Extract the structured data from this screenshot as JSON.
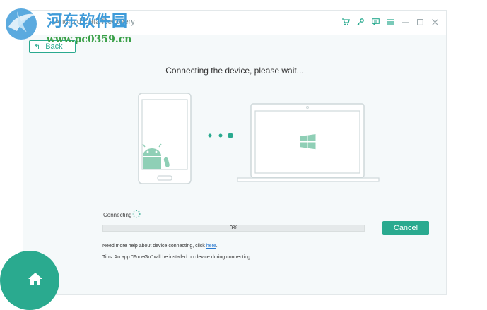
{
  "app": {
    "title": "Android Data Recovery"
  },
  "toolbar": {
    "icons": [
      "cart-icon",
      "key-icon",
      "feedback-icon",
      "menu-icon",
      "minimize-icon",
      "maximize-icon",
      "close-icon"
    ]
  },
  "back": {
    "label": "Back"
  },
  "main": {
    "heading": "Connecting the device, please wait..."
  },
  "progress": {
    "status_label": "Connecting",
    "percent_text": "0%",
    "value": 0
  },
  "actions": {
    "cancel_label": "Cancel"
  },
  "help": {
    "text": "Need more help about device connecting, click ",
    "link": "here",
    "suffix": ".",
    "tips": "Tips: An app \"FoneGo\" will be installed on device during connecting."
  },
  "watermark": {
    "cn": "河东软件园",
    "url": "www.pc0359.cn"
  },
  "colors": {
    "accent": "#2aaa8f",
    "link": "#2b7ad0",
    "watermark_blue": "#3e9bd9",
    "watermark_green": "#3aa048"
  }
}
